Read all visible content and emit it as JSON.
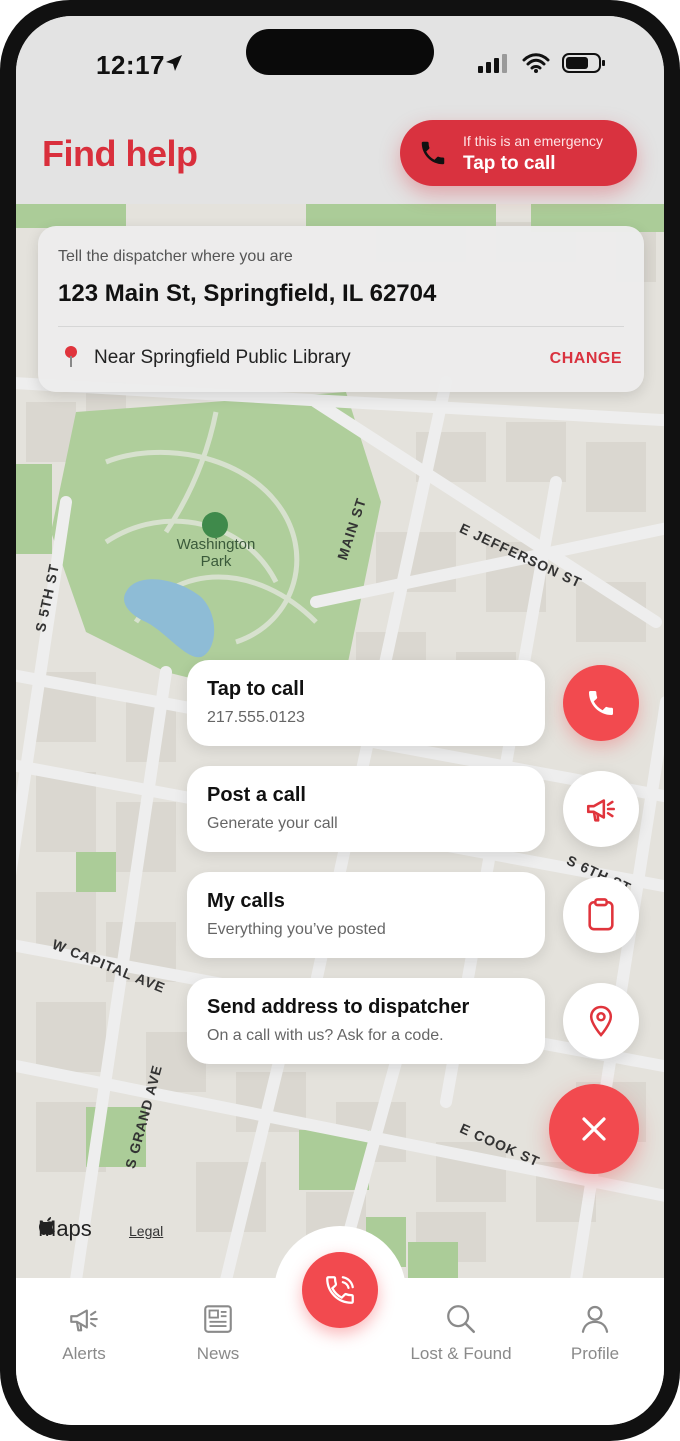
{
  "status_bar": {
    "time": "12:17"
  },
  "header": {
    "title": "Find help",
    "emergency_subtitle": "If this is an emergency",
    "emergency_label": "Tap to call"
  },
  "location_card": {
    "hint": "Tell the dispatcher where you are",
    "address": "123 Main St, Springfield, IL 62704",
    "nearby": "Near Springfield Public Library",
    "change_label": "CHANGE"
  },
  "map": {
    "park_name_line1": "Washington",
    "park_name_line2": "Park",
    "streets": {
      "main_st": "MAIN ST",
      "e_jefferson": "E JEFFERSON ST",
      "s_5th": "S 5TH ST",
      "s_6th": "S 6TH ST",
      "w_capital": "W CAPITAL AVE",
      "s_grand": "S GRAND AVE",
      "e_cook": "E COOK ST"
    },
    "brand": "Maps",
    "legal": "Legal"
  },
  "actions": [
    {
      "title": "Tap to call",
      "subtitle": "217.555.0123",
      "icon": "phone-icon"
    },
    {
      "title": "Post a call",
      "subtitle": "Generate your call",
      "icon": "megaphone-icon"
    },
    {
      "title": "My calls",
      "subtitle": "Everything you’ve posted",
      "icon": "clipboard-icon"
    },
    {
      "title": "Send address to dispatcher",
      "subtitle": "On a call with us? Ask for a code.",
      "icon": "location-pin-icon"
    }
  ],
  "tabs": [
    {
      "label": "Alerts",
      "icon": "megaphone-icon"
    },
    {
      "label": "News",
      "icon": "newspaper-icon"
    },
    {
      "label": "Lost & Found",
      "icon": "search-icon"
    },
    {
      "label": "Profile",
      "icon": "person-icon"
    }
  ],
  "colors": {
    "brand_red": "#d9323f",
    "fab_red": "#f24a4f",
    "park_green": "#8cc46b",
    "water_blue": "#5aa9d6"
  }
}
